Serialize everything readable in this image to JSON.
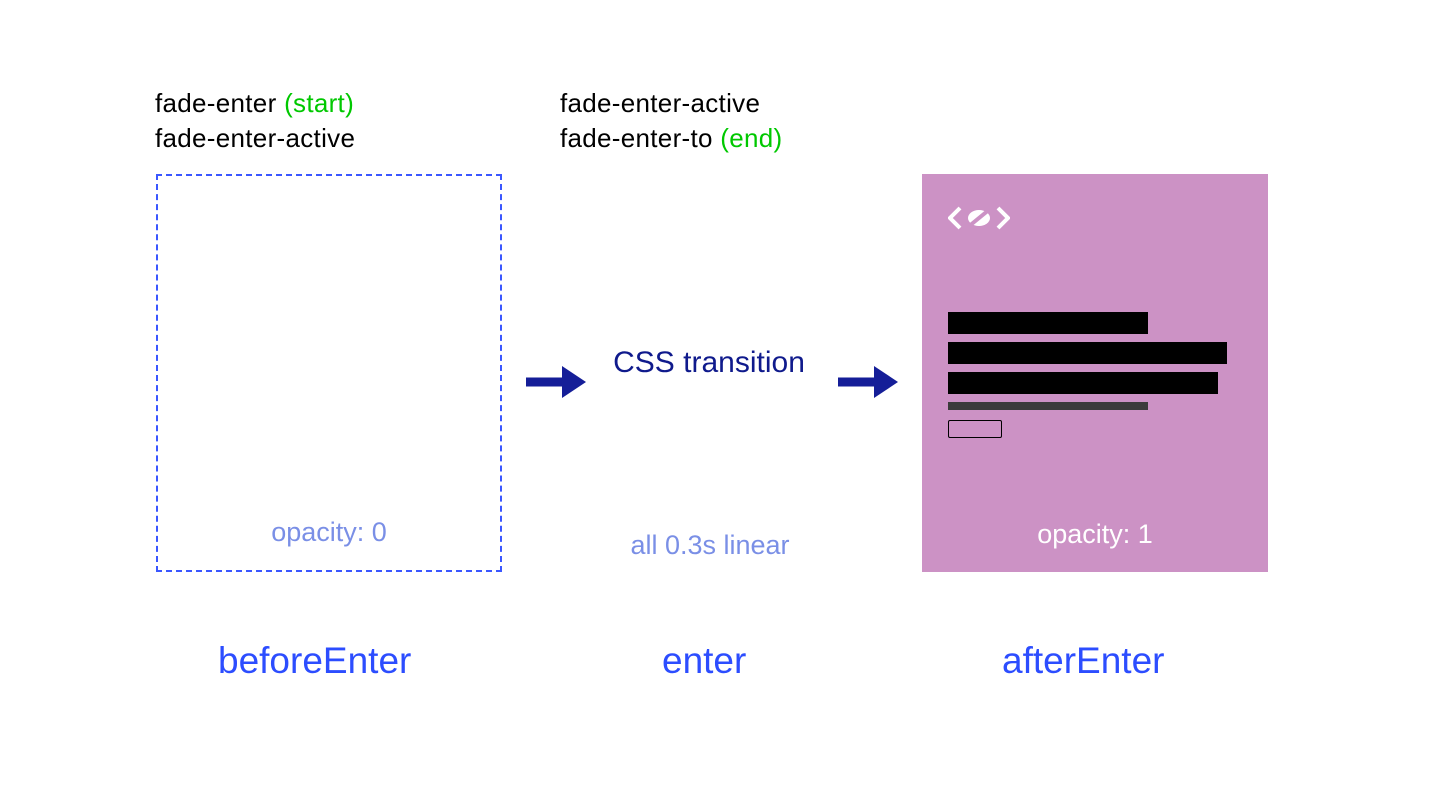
{
  "labels": {
    "left": {
      "line1": {
        "class": "fade-enter",
        "paren": "(start)"
      },
      "line2": {
        "class": "fade-enter-active"
      }
    },
    "mid": {
      "line1": {
        "class": "fade-enter-active"
      },
      "line2": {
        "class": "fade-enter-to",
        "paren": "(end)"
      }
    }
  },
  "placeholder": {
    "opacity_text": "opacity: 0"
  },
  "center": {
    "title": "CSS transition",
    "detail": "all 0.3s linear"
  },
  "filled": {
    "opacity_text": "opacity: 1"
  },
  "hooks": {
    "before": "beforeEnter",
    "enter": "enter",
    "after": "afterEnter"
  },
  "colors": {
    "navy": "#0f1a8c",
    "blue_bright": "#2c4dff",
    "blue_light": "#7a8fe6",
    "green": "#00c800",
    "purple_card": "#cc92c5"
  }
}
